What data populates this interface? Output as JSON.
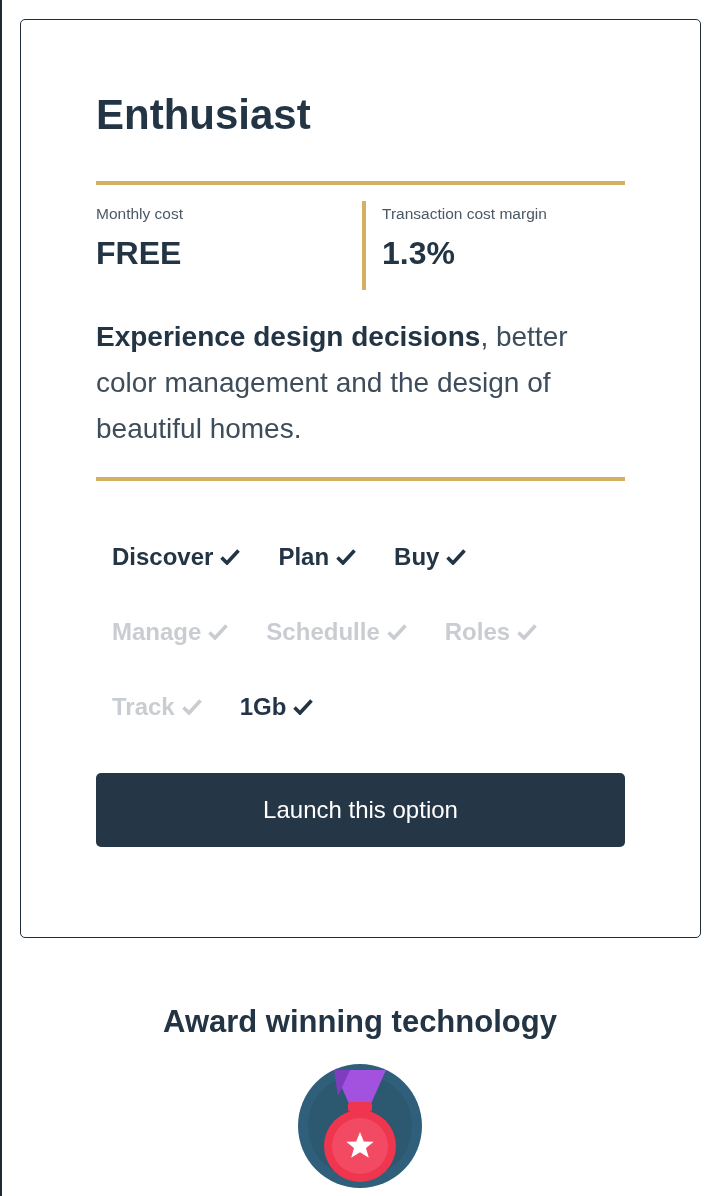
{
  "plan_card": {
    "title": "Enthusiast",
    "stats": [
      {
        "label": "Monthly cost",
        "value": "FREE"
      },
      {
        "label": "Transaction cost margin",
        "value": "1.3%"
      }
    ],
    "description": "**Experience design decisions**, better color management and the design of beautiful homes.",
    "features": [
      {
        "label": "Discover",
        "included": true
      },
      {
        "label": "Plan",
        "included": true
      },
      {
        "label": "Buy",
        "included": true
      },
      {
        "label": "Manage",
        "included": false
      },
      {
        "label": "Schedulle",
        "included": false
      },
      {
        "label": "Roles",
        "included": false
      },
      {
        "label": "Track",
        "included": false
      },
      {
        "label": "1Gb",
        "included": true
      }
    ],
    "button": "Launch this option"
  },
  "award": {
    "title": "Award winning technology"
  }
}
